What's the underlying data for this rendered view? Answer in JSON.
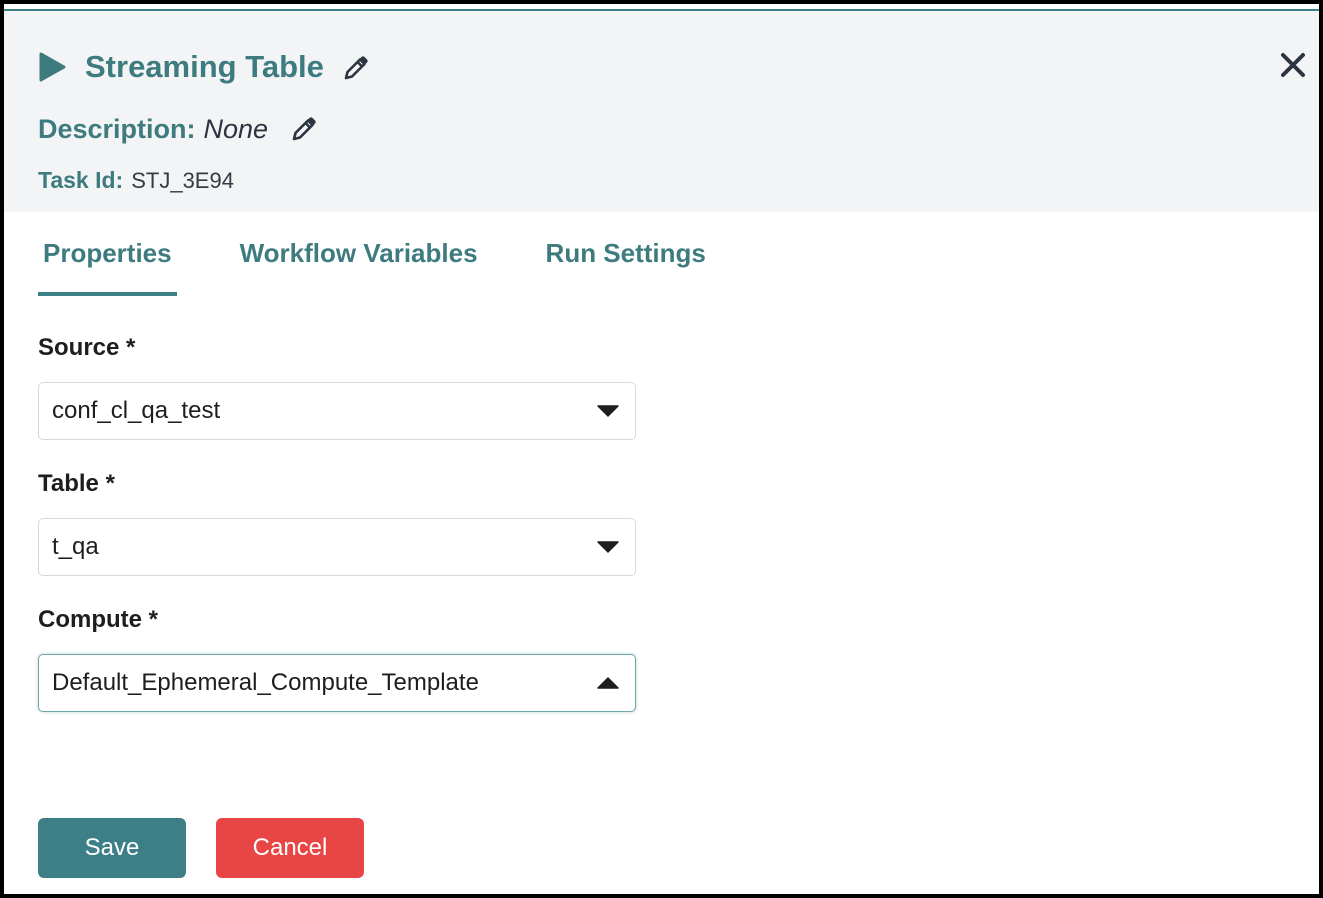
{
  "header": {
    "title": "Streaming Table",
    "description_label": "Description:",
    "description_value": "None",
    "task_id_label": "Task Id:",
    "task_id_value": "STJ_3E94"
  },
  "tabs": [
    {
      "label": "Properties",
      "active": true
    },
    {
      "label": "Workflow Variables",
      "active": false
    },
    {
      "label": "Run Settings",
      "active": false
    }
  ],
  "form": {
    "source": {
      "label": "Source *",
      "value": "conf_cl_qa_test"
    },
    "table": {
      "label": "Table *",
      "value": "t_qa"
    },
    "compute": {
      "label": "Compute *",
      "value": "Default_Ephemeral_Compute_Template",
      "expanded": true
    }
  },
  "buttons": {
    "save": "Save",
    "cancel": "Cancel"
  },
  "icons": {
    "play": "play-icon",
    "edit": "pencil-icon",
    "close": "close-icon",
    "dropdown": "caret-down-icon",
    "dropdown_open": "caret-up-icon"
  },
  "colors": {
    "accent": "#3d7f87",
    "header_bg": "#f2f4f6",
    "danger": "#e84545",
    "text_dark": "#1e1e1e"
  }
}
